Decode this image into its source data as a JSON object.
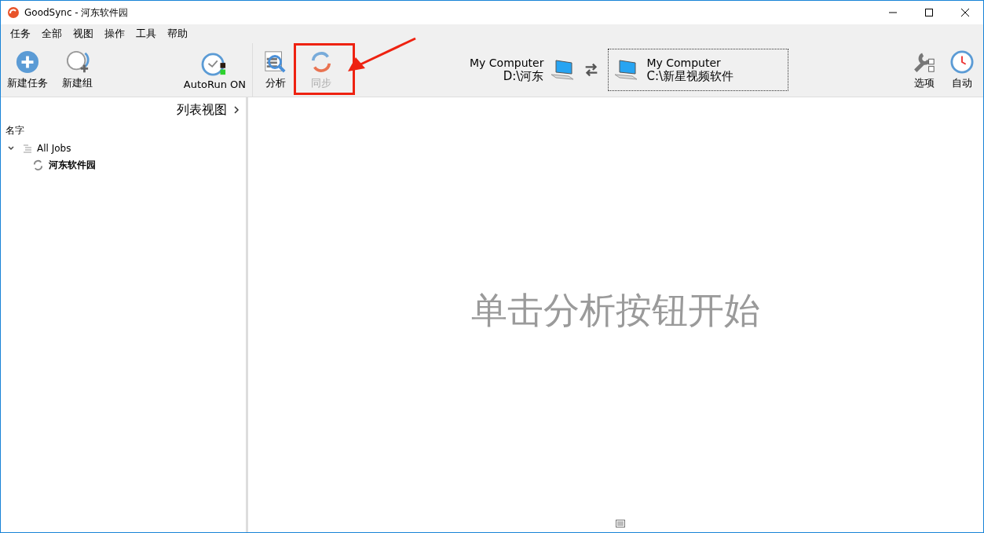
{
  "window": {
    "title": "GoodSync - 河东软件园"
  },
  "menu": [
    "任务",
    "全部",
    "视图",
    "操作",
    "工具",
    "帮助"
  ],
  "left_toolbar": [
    {
      "kind": "new-job",
      "label": "新建任务"
    },
    {
      "kind": "new-group",
      "label": "新建组"
    },
    {
      "kind": "autorun",
      "label": "AutoRun ON"
    }
  ],
  "job_toolbar": [
    {
      "kind": "analyze",
      "label": "分析",
      "disabled": false
    },
    {
      "kind": "sync",
      "label": "同步",
      "disabled": true
    }
  ],
  "left_folder": {
    "name": "My Computer",
    "path": "D:\\河东"
  },
  "right_folder": {
    "name": "My Computer",
    "path": "C:\\新星视频软件"
  },
  "right_toolbar": [
    {
      "kind": "options",
      "label": "选项"
    },
    {
      "kind": "auto",
      "label": "自动"
    }
  ],
  "sidebar": {
    "view_toggle": "列表视图",
    "column": "名字",
    "tree": [
      {
        "label": "All Jobs",
        "expanded": true,
        "children": [
          {
            "label": "河东软件园"
          }
        ]
      }
    ]
  },
  "main": {
    "hint": "单击分析按钮开始"
  }
}
